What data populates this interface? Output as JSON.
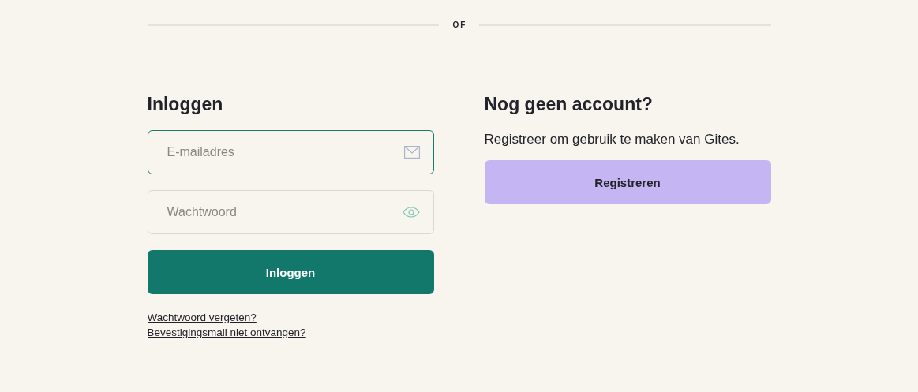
{
  "separator": {
    "label": "OF"
  },
  "login": {
    "title": "Inloggen",
    "fields": [
      {
        "kind": "email",
        "placeholder": "E-mailadres",
        "focused": true
      },
      {
        "kind": "password",
        "placeholder": "Wachtwoord",
        "focused": false
      }
    ],
    "button": "Inloggen",
    "links": [
      "Wachtwoord vergeten?",
      "Bevestigingsmail niet ontvangen?"
    ]
  },
  "register": {
    "title": "Nog geen account?",
    "text": "Registreer om gebruik te maken van Gites.",
    "button": "Registreren"
  }
}
